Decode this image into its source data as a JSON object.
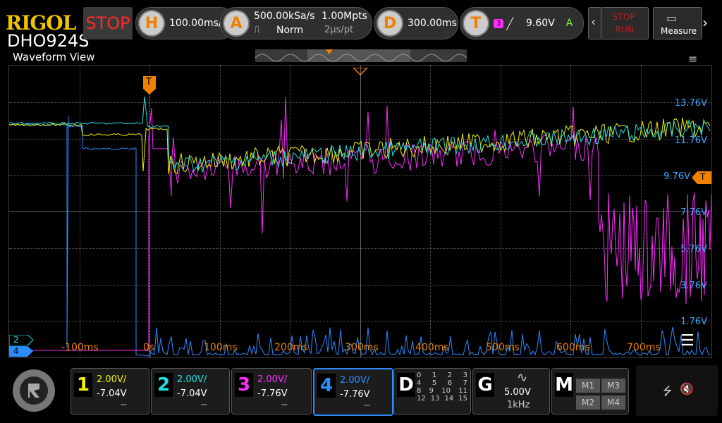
{
  "header": {
    "brand": "RIGOL",
    "model": "DHO924S",
    "run_state": "STOP",
    "horizontal": {
      "key": "H",
      "value": "100.00ms/"
    },
    "acquire": {
      "key": "A",
      "rate": "500.00kSa/s",
      "mode": "Norm",
      "depth": "1.00Mpts",
      "per_point": "2μs/pt"
    },
    "delay": {
      "key": "D",
      "value": "300.00ms"
    },
    "trigger": {
      "key": "T",
      "source": "3",
      "level": "9.60V",
      "coupling": "A"
    },
    "stop_run": [
      "STOP",
      "RUN"
    ],
    "measure_label": "Measure"
  },
  "view": {
    "title": "Waveform View",
    "trigger_marker": "T",
    "y_labels": [
      "13.76V",
      "11.76V",
      "9.76V",
      "7.76V",
      "5.76V",
      "3.76V",
      "1.76V"
    ],
    "x_labels": [
      "-100ms",
      "0s",
      "100ms",
      "200ms",
      "300ms",
      "400ms",
      "500ms",
      "600ms",
      "700ms"
    ],
    "ch_markers": [
      "2",
      "4"
    ]
  },
  "channels": [
    {
      "num": "1",
      "scale": "2.00V/",
      "offset": "-7.04V",
      "color": "#f4f000"
    },
    {
      "num": "2",
      "scale": "2.00V/",
      "offset": "-7.04V",
      "color": "#20e0e0"
    },
    {
      "num": "3",
      "scale": "2.00V/",
      "offset": "-7.76V",
      "color": "#ff2cff"
    },
    {
      "num": "4",
      "scale": "2.00V/",
      "offset": "-7.76V",
      "color": "#2a8cff"
    }
  ],
  "digital": {
    "key": "D",
    "rows": [
      [
        "0",
        "1",
        "2",
        "3"
      ],
      [
        "4",
        "5",
        "6",
        "7"
      ],
      [
        "8",
        "9",
        "10",
        "11"
      ],
      [
        "12",
        "13",
        "14",
        "15"
      ]
    ]
  },
  "generator": {
    "key": "G",
    "amplitude": "5.00V",
    "freq": "1kHz"
  },
  "math": {
    "key": "M",
    "buttons": [
      "M1",
      "M3",
      "M2",
      "M4"
    ]
  }
}
